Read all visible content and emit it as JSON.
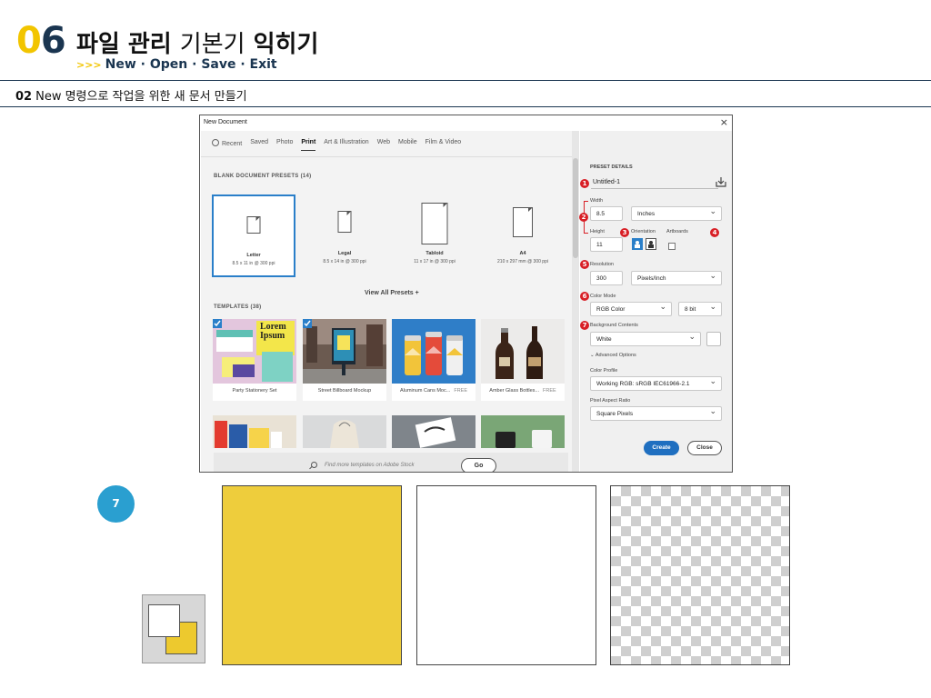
{
  "slide": {
    "chapter_digit1": "0",
    "chapter_digit2": "6",
    "title_bold1": "파일 관리",
    "title_light": "기본기",
    "title_bold2": "익히기",
    "subtitle_arrows": ">>>",
    "subtitle": "New · Open · Save · Exit",
    "section_num": "02",
    "section_title": "New 명령으로 작업을 위한 새 문서 만들기",
    "step_number": "7"
  },
  "dialog": {
    "title": "New Document",
    "close": "×",
    "tabs": [
      {
        "label": "Recent",
        "active": false
      },
      {
        "label": "Saved",
        "active": false
      },
      {
        "label": "Photo",
        "active": false
      },
      {
        "label": "Print",
        "active": true
      },
      {
        "label": "Art & Illustration",
        "active": false
      },
      {
        "label": "Web",
        "active": false
      },
      {
        "label": "Mobile",
        "active": false
      },
      {
        "label": "Film & Video",
        "active": false
      }
    ],
    "presets_header": "BLANK DOCUMENT PRESETS  (14)",
    "presets": [
      {
        "name": "Letter",
        "size": "8.5 x 11 in @ 300 ppi"
      },
      {
        "name": "Legal",
        "size": "8.5 x 14 in @ 300 ppi"
      },
      {
        "name": "Tabloid",
        "size": "11 x 17 in @ 300 ppi"
      },
      {
        "name": "A4",
        "size": "210 x 297 mm @ 300 ppi"
      }
    ],
    "view_all": "View All Presets +",
    "templates_header": "TEMPLATES  (38)",
    "templates": [
      {
        "name": "Party Stationery Set",
        "badge": ""
      },
      {
        "name": "Street Billboard Mockup",
        "badge": ""
      },
      {
        "name": "Aluminum Cans Moc...",
        "badge": "FREE"
      },
      {
        "name": "Amber Glass Bottles...",
        "badge": "FREE"
      }
    ],
    "lorem_text": "Lorem Ipsum",
    "search_placeholder": "Find more templates on Adobe Stock",
    "go_label": "Go"
  },
  "preset_details": {
    "header": "PRESET DETAILS",
    "name": "Untitled-1",
    "width_label": "Width",
    "width_value": "8.5",
    "width_unit": "Inches",
    "height_label": "Height",
    "height_value": "11",
    "orientation_label": "Orientation",
    "artboards_label": "Artboards",
    "resolution_label": "Resolution",
    "resolution_value": "300",
    "resolution_unit": "Pixels/Inch",
    "color_mode_label": "Color Mode",
    "color_mode_value": "RGB Color",
    "bit_depth": "8 bit",
    "bg_contents_label": "Background Contents",
    "bg_contents_value": "White",
    "advanced_label": "Advanced Options",
    "color_profile_label": "Color Profile",
    "color_profile_value": "Working RGB: sRGB IEC61966-2.1",
    "pixel_ratio_label": "Pixel Aspect Ratio",
    "pixel_ratio_value": "Square Pixels",
    "create_label": "Create",
    "close_label": "Close",
    "badges": [
      "1",
      "2",
      "3",
      "4",
      "5",
      "6",
      "7"
    ]
  },
  "colors": {
    "accent_blue": "#1f6fc0",
    "callout_red": "#d81f26",
    "brand_yellow": "#f2c500",
    "brand_navy": "#1a3550",
    "bg_yellow": "#eecd3c"
  }
}
